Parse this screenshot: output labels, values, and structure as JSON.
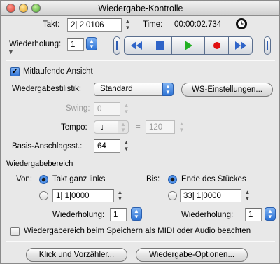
{
  "window": {
    "title": "Wiedergabe-Kontrolle"
  },
  "transport": {
    "takt_label": "Takt:",
    "takt_value": "2| 2|0106",
    "time_label": "Time:",
    "time_value": "00:00:02.734",
    "wiederholung_label": "Wiederholung:",
    "wiederholung_value": "1"
  },
  "view": {
    "mitlaufende_label": "Mitlaufende Ansicht",
    "mitlaufende_checked": true
  },
  "style": {
    "label": "Wiedergabestilistik:",
    "selected": "Standard",
    "ws_button": "WS-Einstellungen...",
    "swing_label": "Swing:",
    "swing_value": "0",
    "tempo_label": "Tempo:",
    "tempo_note": "♩",
    "tempo_equals": "=",
    "tempo_value": "120",
    "basis_label": "Basis-Anschlagsst.:",
    "basis_value": "64"
  },
  "range": {
    "section_label": "Wiedergabebereich",
    "von_label": "Von:",
    "von_option1": "Takt ganz links",
    "von_value": "1| 1|0000",
    "von_wiederholung_label": "Wiederholung:",
    "von_wiederholung_value": "1",
    "bis_label": "Bis:",
    "bis_option1": "Ende des Stückes",
    "bis_value": "33| 1|0000",
    "bis_wiederholung_label": "Wiederholung:",
    "bis_wiederholung_value": "1",
    "midi_label": "Wiedergabereich beim Speichern als MIDI oder Audio beachten"
  },
  "footer": {
    "klick_button": "Klick und Vorzähler...",
    "optionen_button": "Wiedergabe-Optionen..."
  },
  "colors": {
    "accent_blue": "#2f72d4",
    "record_red": "#e01010",
    "play_green": "#22b022"
  }
}
